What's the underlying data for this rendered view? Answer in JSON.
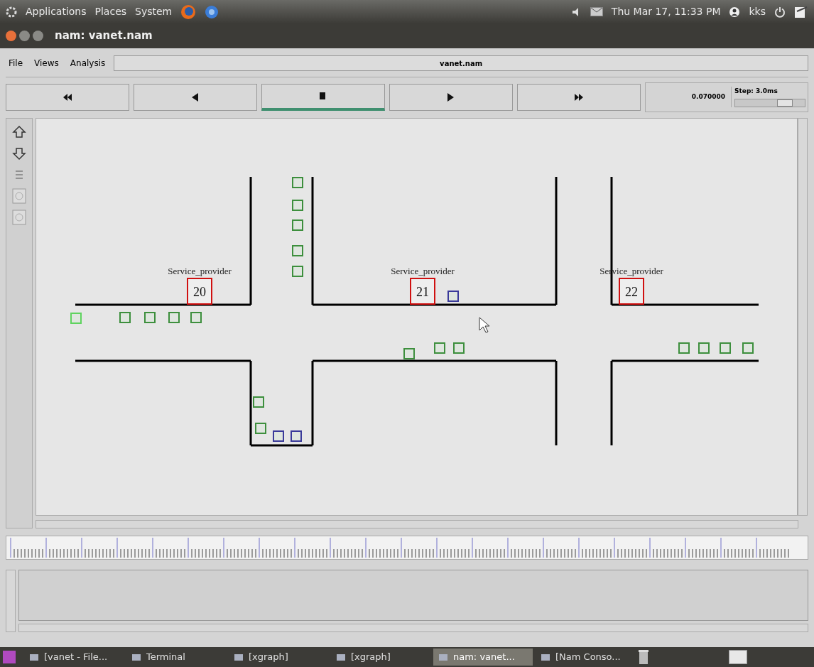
{
  "top_panel": {
    "menus": [
      "Applications",
      "Places",
      "System"
    ],
    "clock": "Thu Mar 17, 11:33 PM",
    "user": "kks"
  },
  "window": {
    "title": "nam: vanet.nam"
  },
  "menu": [
    "File",
    "Views",
    "Analysis"
  ],
  "file_name": "vanet.nam",
  "transport": [
    {
      "kind": "fast-rewind",
      "selected": false
    },
    {
      "kind": "rewind",
      "selected": false
    },
    {
      "kind": "stop",
      "selected": true
    },
    {
      "kind": "play",
      "selected": false
    },
    {
      "kind": "fast-forward",
      "selected": false
    }
  ],
  "time": "0.070000",
  "step": {
    "label": "Step: 3.0ms",
    "level": 0.75
  },
  "canvas": {
    "service_providers": [
      {
        "label": "Service_provider",
        "id": "20"
      },
      {
        "label": "Service_provider",
        "id": "21"
      },
      {
        "label": "Service_provider",
        "id": "22"
      }
    ],
    "nodes": [
      {
        "color": "#3d8f3d"
      },
      {
        "color": "#3d8f3d"
      },
      {
        "color": "#3d8f3d"
      },
      {
        "color": "#3d8f3d"
      },
      {
        "color": "#3d8f3d"
      },
      {
        "color": "#5fd35f"
      },
      {
        "color": "#3d8f3d"
      },
      {
        "color": "#3d8f3d"
      },
      {
        "color": "#3d8f3d"
      },
      {
        "color": "#3d8f3d"
      },
      {
        "color": "#3d8f3d"
      },
      {
        "color": "#3d8f3d"
      },
      {
        "color": "#3d8f3d"
      },
      {
        "color": "#3d8f3d"
      },
      {
        "color": "#3d8f3d"
      },
      {
        "color": "#3d8f3d"
      },
      {
        "color": "#3d8f3d"
      },
      {
        "color": "#3d8f3d"
      },
      {
        "color": "#3d8f3d"
      },
      {
        "color": "#3a3a9a"
      },
      {
        "color": "#3a3a9a"
      },
      {
        "color": "#3a3a9a"
      }
    ]
  },
  "taskbar": [
    {
      "label": "[vanet - File...",
      "selected": false
    },
    {
      "label": "Terminal",
      "selected": false
    },
    {
      "label": "[xgraph]",
      "selected": false
    },
    {
      "label": "[xgraph]",
      "selected": false
    },
    {
      "label": "nam: vanet...",
      "selected": true
    },
    {
      "label": "[Nam Conso...",
      "selected": false
    }
  ]
}
